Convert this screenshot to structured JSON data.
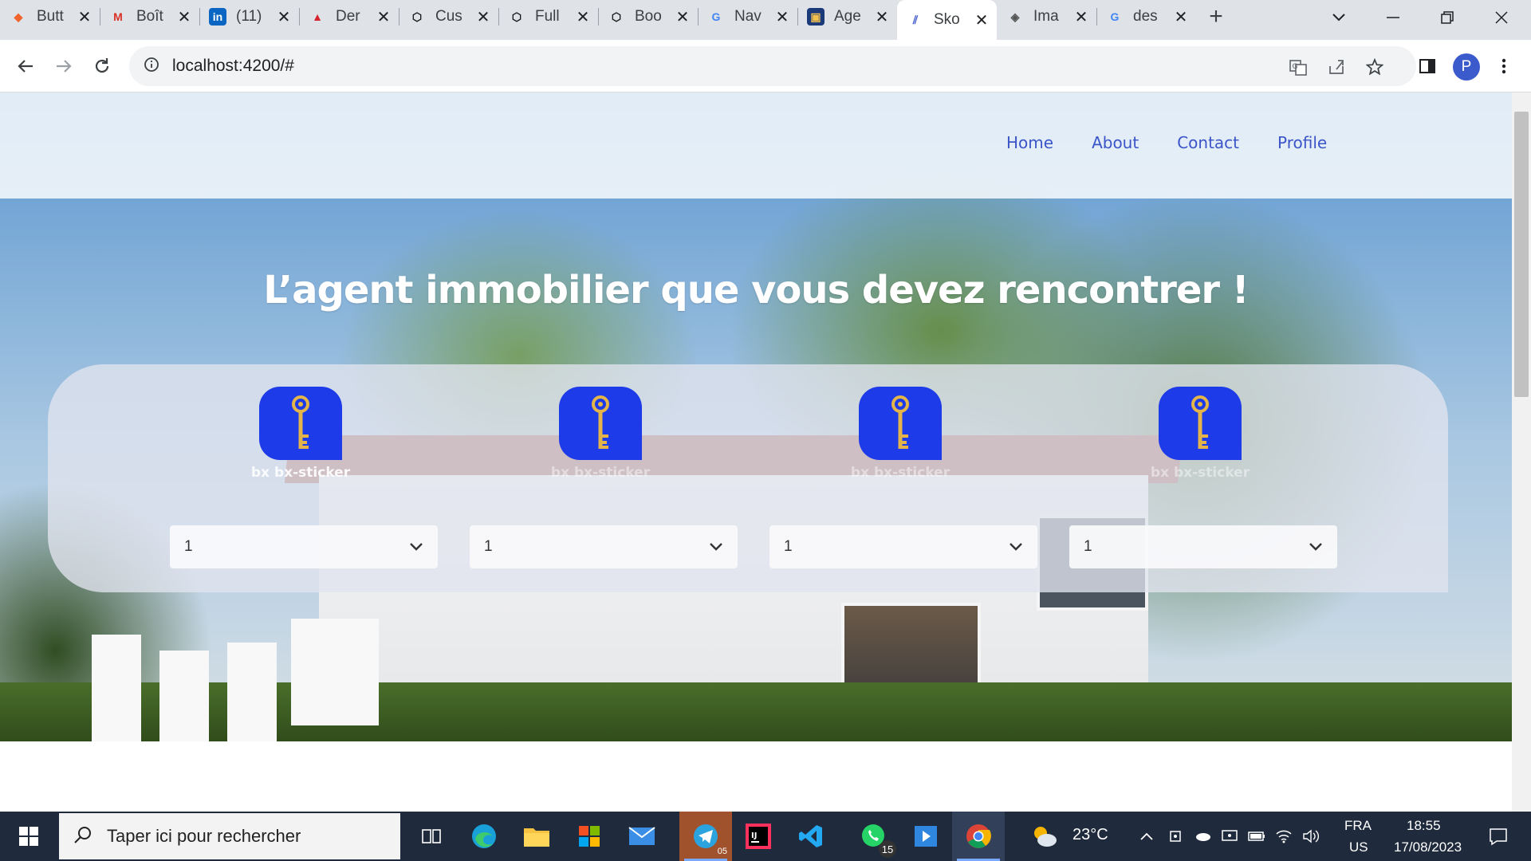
{
  "browser": {
    "tabs": [
      {
        "label": "Butt",
        "favicon": "brave-icon",
        "color": "#f0652f"
      },
      {
        "label": "Boît",
        "favicon": "gmail-icon",
        "color": "#d93025"
      },
      {
        "label": "(11)",
        "favicon": "linkedin-icon",
        "color": "#0a66c2"
      },
      {
        "label": "Der",
        "favicon": "angular-icon",
        "color": "#d6232e"
      },
      {
        "label": "Cus",
        "favicon": "codesandbox-icon",
        "color": "#151515"
      },
      {
        "label": "Full",
        "favicon": "codesandbox-icon",
        "color": "#151515"
      },
      {
        "label": "Boo",
        "favicon": "codesandbox-icon",
        "color": "#151515"
      },
      {
        "label": "Nav",
        "favicon": "google-icon",
        "color": "#4285f4"
      },
      {
        "label": "Age",
        "favicon": "contacts-icon",
        "color": "#1a3a7a"
      },
      {
        "label": "Sko",
        "favicon": "stripes-icon",
        "color": "#3b55c8",
        "active": true
      },
      {
        "label": "Ima",
        "favicon": "layers-icon",
        "color": "#555"
      },
      {
        "label": "des",
        "favicon": "google-icon",
        "color": "#4285f4"
      }
    ],
    "url": "localhost:4200/#",
    "profile_initial": "P"
  },
  "page": {
    "nav": [
      "Home",
      "About",
      "Contact",
      "Profile"
    ],
    "headline": "L’agent immobilier que vous devez rencontrer !",
    "cards": [
      {
        "label": "bx bx-sticker",
        "select_value": "1"
      },
      {
        "label": "bx bx-sticker",
        "select_value": "1"
      },
      {
        "label": "bx bx-sticker",
        "select_value": "1"
      },
      {
        "label": "bx bx-sticker",
        "select_value": "1"
      }
    ],
    "colors": {
      "accent": "#1d3be8",
      "nav_link": "#3b55c8",
      "key": "#e2b44a"
    }
  },
  "taskbar": {
    "search_placeholder": "Taper ici pour rechercher",
    "apps": [
      "task-view-icon",
      "edge-icon",
      "file-explorer-icon",
      "store-icon",
      "mail-icon",
      "telegram-icon",
      "intellij-icon",
      "vscode-icon",
      "whatsapp-icon",
      "media-icon",
      "chrome-icon"
    ],
    "telegram_badge": "05",
    "whatsapp_badge": "15",
    "weather": "23°C",
    "lang_top": "FRA",
    "lang_bottom": "US",
    "time": "18:55",
    "date": "17/08/2023"
  }
}
